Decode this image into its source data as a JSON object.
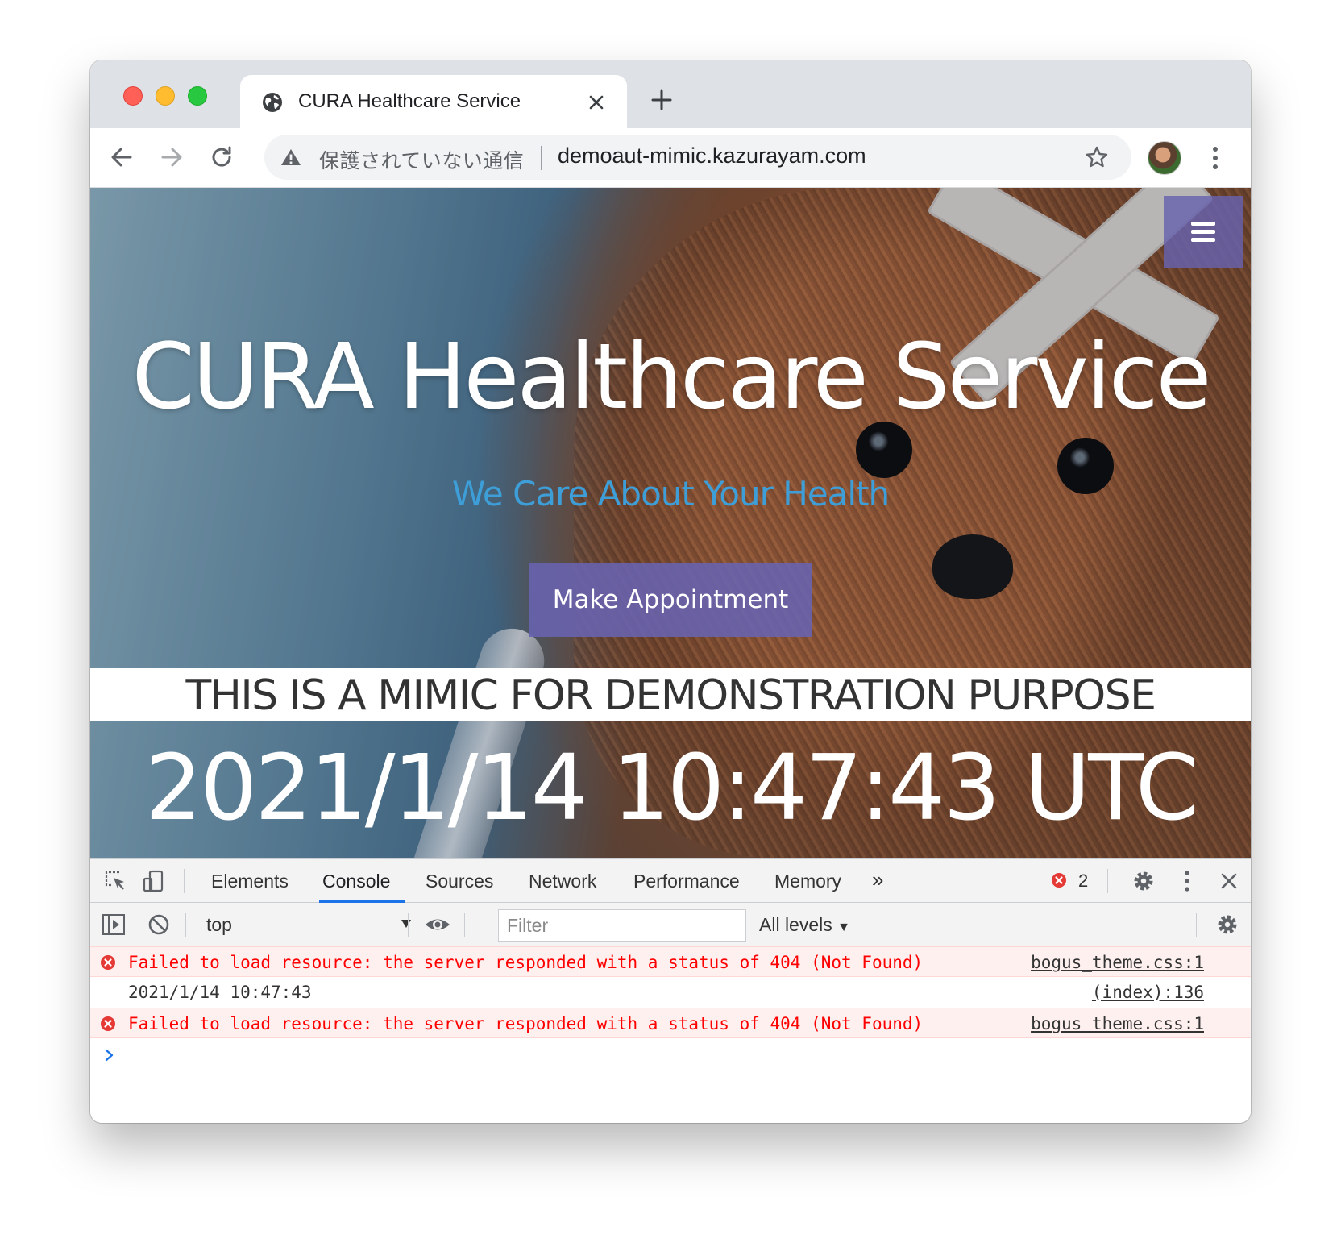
{
  "browser": {
    "tab_title": "CURA Healthcare Service",
    "address": {
      "security_label": "保護されていない通信",
      "url": "demoaut-mimic.kazurayam.com"
    },
    "icons": [
      "globe-icon",
      "close-icon",
      "plus-icon",
      "back-icon",
      "forward-icon",
      "reload-icon",
      "warning-icon",
      "star-icon",
      "avatar",
      "kebab-menu-icon"
    ]
  },
  "page": {
    "title": "CURA Healthcare Service",
    "subtitle": "We Care About Your Health",
    "cta_label": "Make Appointment",
    "banner": "THIS IS A MIMIC FOR DEMONSTRATION PURPOSE",
    "clock": "2021/1/14 10:47:43 UTC",
    "colors": {
      "accent": "#6863ae",
      "subtitle": "#3d9ed8"
    }
  },
  "devtools": {
    "tabs": [
      "Elements",
      "Console",
      "Sources",
      "Network",
      "Performance",
      "Memory"
    ],
    "active_tab": "Console",
    "more_tabs": "»",
    "error_count": "2",
    "context": "top",
    "filter_placeholder": "Filter",
    "levels": "All levels",
    "messages": [
      {
        "type": "error",
        "text": "Failed to load resource: the server responded with a status of 404 (Not Found)",
        "source": "bogus_theme.css:1"
      },
      {
        "type": "log",
        "text": "2021/1/14 10:47:43",
        "source": "(index):136"
      },
      {
        "type": "error",
        "text": "Failed to load resource: the server responded with a status of 404 (Not Found)",
        "source": "bogus_theme.css:1"
      }
    ],
    "colors": {
      "error": "#ff0000",
      "active_underline": "#1a73e8"
    }
  }
}
